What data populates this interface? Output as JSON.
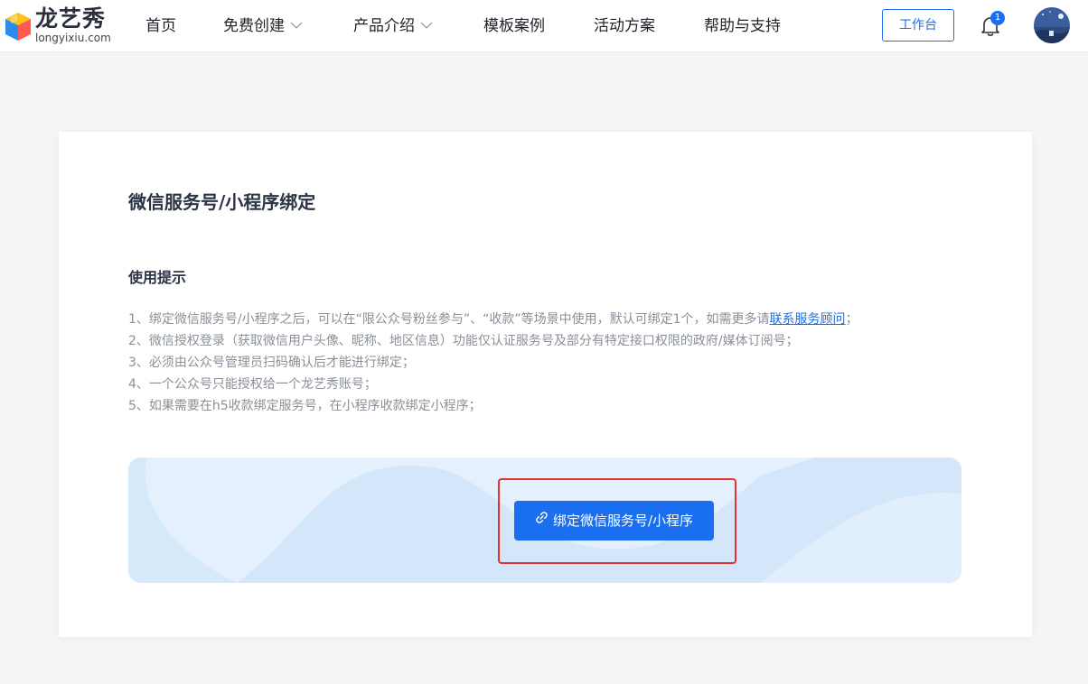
{
  "brand": {
    "name_cn": "龙艺秀",
    "domain": "longyixiu.com"
  },
  "nav": {
    "items": [
      {
        "label": "首页",
        "dropdown": false
      },
      {
        "label": "免费创建",
        "dropdown": true
      },
      {
        "label": "产品介绍",
        "dropdown": true
      },
      {
        "label": "模板案例",
        "dropdown": false
      },
      {
        "label": "活动方案",
        "dropdown": false
      },
      {
        "label": "帮助与支持",
        "dropdown": false
      }
    ],
    "workbench_label": "工作台",
    "notification_count": "1"
  },
  "page": {
    "title": "微信服务号/小程序绑定",
    "tips_title": "使用提示",
    "tips": [
      {
        "text": "1、绑定微信服务号/小程序之后，可以在“限公众号粉丝参与”、“收款”等场景中使用，默认可绑定1个，如需更多请",
        "link": "联系服务顾问",
        "suffix": "；"
      },
      {
        "text": "2、微信授权登录（获取微信用户头像、昵称、地区信息）功能仅认证服务号及部分有特定接口权限的政府/媒体订阅号；"
      },
      {
        "text": "3、必须由公众号管理员扫码确认后才能进行绑定；"
      },
      {
        "text": "4、一个公众号只能授权给一个龙艺秀账号；"
      },
      {
        "text": "5、如果需要在h5收款绑定服务号，在小程序收款绑定小程序；"
      }
    ],
    "bind_button_label": "绑定微信服务号/小程序"
  },
  "colors": {
    "primary": "#1a6ff0",
    "highlight_border": "#e4312b",
    "banner_bg": "#e4f0fd",
    "tip_text": "#8a8f99",
    "title_text": "#2c3345"
  },
  "icons": {
    "logo": "cube-logo-icon",
    "dropdown": "chevron-down-icon",
    "notification": "bell-icon",
    "link": "link-icon"
  }
}
